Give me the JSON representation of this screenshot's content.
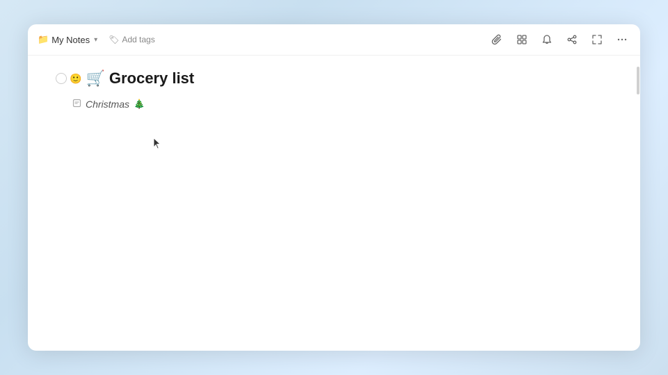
{
  "toolbar": {
    "breadcrumb_icon": "📁",
    "breadcrumb_label": "My Notes",
    "breadcrumb_chevron": "▼",
    "add_tags_icon": "🏷",
    "add_tags_label": "Add tags",
    "icons": [
      {
        "name": "attachment-icon",
        "symbol": "📎",
        "label": "Attach"
      },
      {
        "name": "grid-icon",
        "symbol": "⊞",
        "label": "Grid"
      },
      {
        "name": "bell-icon",
        "symbol": "🔔",
        "label": "Notifications"
      },
      {
        "name": "share-icon",
        "symbol": "↑",
        "label": "Share"
      },
      {
        "name": "expand-icon",
        "symbol": "⤢",
        "label": "Expand"
      },
      {
        "name": "more-icon",
        "symbol": "•••",
        "label": "More"
      }
    ]
  },
  "note": {
    "title": "Grocery list",
    "title_emoji": "🛒",
    "sub_item": {
      "label": "Christmas",
      "emoji": "🎄"
    }
  }
}
